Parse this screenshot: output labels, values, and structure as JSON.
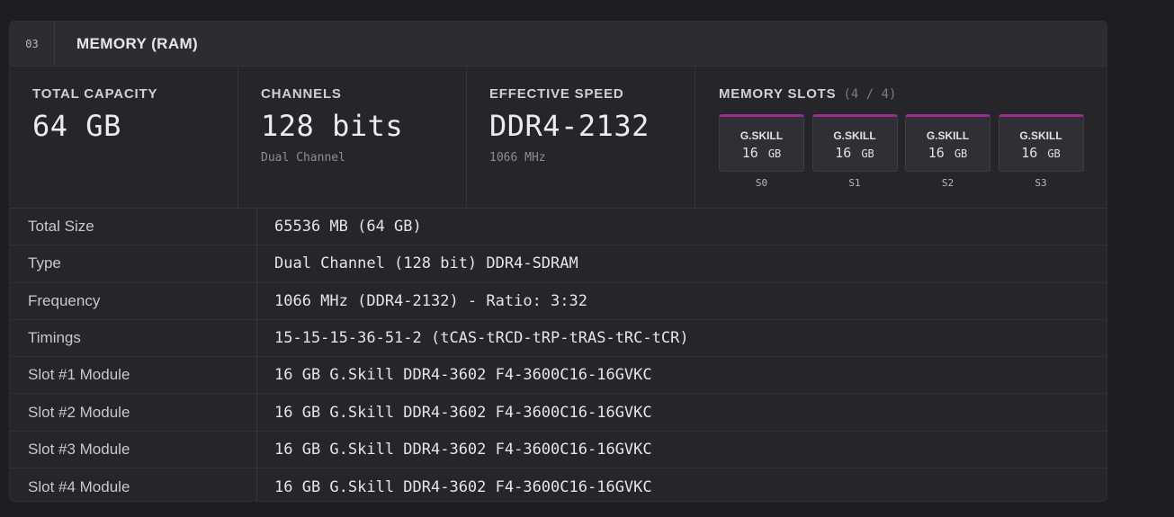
{
  "header": {
    "section_number": "03",
    "title": "MEMORY (RAM)"
  },
  "stats": [
    {
      "label": "TOTAL CAPACITY",
      "value": "64 GB",
      "sub": ""
    },
    {
      "label": "CHANNELS",
      "value": "128 bits",
      "sub": "Dual Channel"
    },
    {
      "label": "EFFECTIVE SPEED",
      "value": "DDR4-2132",
      "sub": "1066 MHz"
    }
  ],
  "slots": {
    "label": "MEMORY SLOTS",
    "count": "(4 / 4)",
    "accent_color": "#9b2c8e",
    "items": [
      {
        "brand": "G.SKILL",
        "size": "16",
        "unit": "GB",
        "id": "S0"
      },
      {
        "brand": "G.SKILL",
        "size": "16",
        "unit": "GB",
        "id": "S1"
      },
      {
        "brand": "G.SKILL",
        "size": "16",
        "unit": "GB",
        "id": "S2"
      },
      {
        "brand": "G.SKILL",
        "size": "16",
        "unit": "GB",
        "id": "S3"
      }
    ]
  },
  "table": [
    {
      "key": "Total Size",
      "value": "65536 MB (64 GB)"
    },
    {
      "key": "Type",
      "value": "Dual Channel (128 bit) DDR4-SDRAM"
    },
    {
      "key": "Frequency",
      "value": "1066 MHz (DDR4-2132) - Ratio: 3:32"
    },
    {
      "key": "Timings",
      "value": "15-15-15-36-51-2 (tCAS-tRCD-tRP-tRAS-tRC-tCR)"
    },
    {
      "key": "Slot #1 Module",
      "value": "16 GB G.Skill DDR4-3602 F4-3600C16-16GVKC"
    },
    {
      "key": "Slot #2 Module",
      "value": "16 GB G.Skill DDR4-3602 F4-3600C16-16GVKC"
    },
    {
      "key": "Slot #3 Module",
      "value": "16 GB G.Skill DDR4-3602 F4-3600C16-16GVKC"
    },
    {
      "key": "Slot #4 Module",
      "value": "16 GB G.Skill DDR4-3602 F4-3600C16-16GVKC"
    }
  ]
}
